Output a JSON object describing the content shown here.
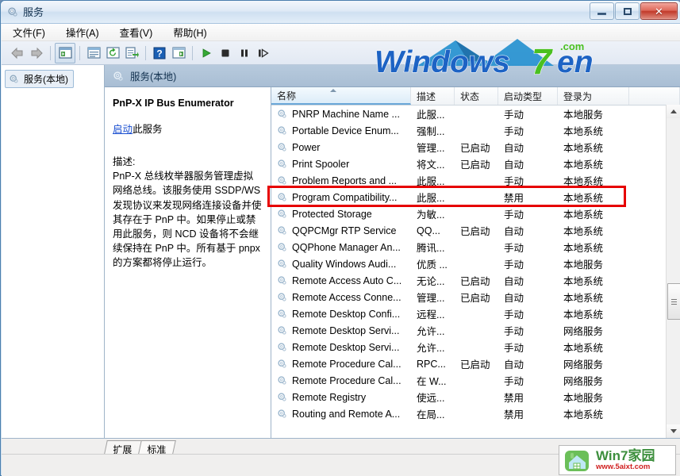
{
  "window": {
    "title": "服务",
    "icon": "services-gear-icon",
    "buttons": {
      "minimize": "minimize-button",
      "restore": "restore-button",
      "close": "close-button"
    }
  },
  "menubar": {
    "items": [
      {
        "label": "文件(F)",
        "name": "menu-file"
      },
      {
        "label": "操作(A)",
        "name": "menu-action"
      },
      {
        "label": "查看(V)",
        "name": "menu-view"
      },
      {
        "label": "帮助(H)",
        "name": "menu-help"
      }
    ]
  },
  "toolbar": {
    "buttons": [
      {
        "name": "back-button",
        "icon": "arrow-left-icon"
      },
      {
        "name": "forward-button",
        "icon": "arrow-right-icon"
      },
      {
        "name": "show-hide-tree-button",
        "icon": "tree-pane-icon"
      },
      {
        "name": "properties-button",
        "icon": "properties-icon"
      },
      {
        "name": "refresh-button",
        "icon": "refresh-icon"
      },
      {
        "name": "export-list-button",
        "icon": "export-list-icon"
      },
      {
        "name": "help-button",
        "icon": "question-mark-icon"
      },
      {
        "name": "show-action-pane-button",
        "icon": "action-pane-icon"
      },
      {
        "name": "start-service-button",
        "icon": "play-icon"
      },
      {
        "name": "stop-service-button",
        "icon": "stop-icon"
      },
      {
        "name": "pause-service-button",
        "icon": "pause-icon"
      },
      {
        "name": "restart-service-button",
        "icon": "restart-icon"
      }
    ]
  },
  "tree": {
    "root_label": "服务(本地)"
  },
  "content_header": {
    "label": "服务(本地)",
    "icon": "services-gear-icon"
  },
  "detail": {
    "title": "PnP-X IP Bus Enumerator",
    "action_link": "启动",
    "action_suffix": "此服务",
    "description_label": "描述:",
    "description": "PnP-X 总线枚举器服务管理虚拟网络总线。该服务使用 SSDP/WS 发现协议来发现网络连接设备并使其存在于 PnP 中。如果停止或禁用此服务，则 NCD 设备将不会继续保持在 PnP 中。所有基于 pnpx 的方案都将停止运行。"
  },
  "list": {
    "columns": [
      {
        "label": "名称",
        "name": "column-name",
        "sorted": true,
        "sort_dir": "asc"
      },
      {
        "label": "描述",
        "name": "column-description",
        "sorted": false
      },
      {
        "label": "状态",
        "name": "column-status",
        "sorted": false
      },
      {
        "label": "启动类型",
        "name": "column-startup-type",
        "sorted": false
      },
      {
        "label": "登录为",
        "name": "column-log-on-as",
        "sorted": false
      }
    ],
    "rows": [
      {
        "name": "PNRP Machine Name ...",
        "description": "此服...",
        "status": "",
        "startup": "手动",
        "logon": "本地服务",
        "highlighted": false
      },
      {
        "name": "Portable Device Enum...",
        "description": "强制...",
        "status": "",
        "startup": "手动",
        "logon": "本地系统",
        "highlighted": false
      },
      {
        "name": "Power",
        "description": "管理...",
        "status": "已启动",
        "startup": "自动",
        "logon": "本地系统",
        "highlighted": false
      },
      {
        "name": "Print Spooler",
        "description": "将文...",
        "status": "已启动",
        "startup": "自动",
        "logon": "本地系统",
        "highlighted": false
      },
      {
        "name": "Problem Reports and ...",
        "description": "此服...",
        "status": "",
        "startup": "手动",
        "logon": "本地系统",
        "highlighted": false
      },
      {
        "name": "Program Compatibility...",
        "description": "此服...",
        "status": "",
        "startup": "禁用",
        "logon": "本地系统",
        "highlighted": true
      },
      {
        "name": "Protected Storage",
        "description": "为敏...",
        "status": "",
        "startup": "手动",
        "logon": "本地系统",
        "highlighted": false
      },
      {
        "name": "QQPCMgr RTP Service",
        "description": "QQ...",
        "status": "已启动",
        "startup": "自动",
        "logon": "本地系统",
        "highlighted": false
      },
      {
        "name": "QQPhone Manager An...",
        "description": "腾讯...",
        "status": "",
        "startup": "手动",
        "logon": "本地系统",
        "highlighted": false
      },
      {
        "name": "Quality Windows Audi...",
        "description": "优质 ...",
        "status": "",
        "startup": "手动",
        "logon": "本地服务",
        "highlighted": false
      },
      {
        "name": "Remote Access Auto C...",
        "description": "无论...",
        "status": "已启动",
        "startup": "自动",
        "logon": "本地系统",
        "highlighted": false
      },
      {
        "name": "Remote Access Conne...",
        "description": "管理...",
        "status": "已启动",
        "startup": "自动",
        "logon": "本地系统",
        "highlighted": false
      },
      {
        "name": "Remote Desktop Confi...",
        "description": "远程...",
        "status": "",
        "startup": "手动",
        "logon": "本地系统",
        "highlighted": false
      },
      {
        "name": "Remote Desktop Servi...",
        "description": "允许...",
        "status": "",
        "startup": "手动",
        "logon": "网络服务",
        "highlighted": false
      },
      {
        "name": "Remote Desktop Servi...",
        "description": "允许...",
        "status": "",
        "startup": "手动",
        "logon": "本地系统",
        "highlighted": false
      },
      {
        "name": "Remote Procedure Cal...",
        "description": "RPC...",
        "status": "已启动",
        "startup": "自动",
        "logon": "网络服务",
        "highlighted": false
      },
      {
        "name": "Remote Procedure Cal...",
        "description": "在 W...",
        "status": "",
        "startup": "手动",
        "logon": "网络服务",
        "highlighted": false
      },
      {
        "name": "Remote Registry",
        "description": "使远...",
        "status": "",
        "startup": "禁用",
        "logon": "本地服务",
        "highlighted": false
      },
      {
        "name": "Routing and Remote A...",
        "description": "在局...",
        "status": "",
        "startup": "禁用",
        "logon": "本地系统",
        "highlighted": false
      }
    ],
    "row_icon": "service-gear-icon",
    "highlight_color": "#e60000"
  },
  "scrollbar": {
    "up_arrow": "scroll-up-arrow-icon",
    "down_arrow": "scroll-down-arrow-icon",
    "thumb": "scroll-thumb"
  },
  "tabs": [
    {
      "label": "扩展",
      "name": "tab-extended",
      "active": false
    },
    {
      "label": "标准",
      "name": "tab-standard",
      "active": true
    }
  ],
  "watermarks": {
    "top": {
      "text": "Windows7en",
      "suffix": ".com"
    },
    "bottom": {
      "title": "Win7家园",
      "url": "www.5aixt.com"
    }
  }
}
